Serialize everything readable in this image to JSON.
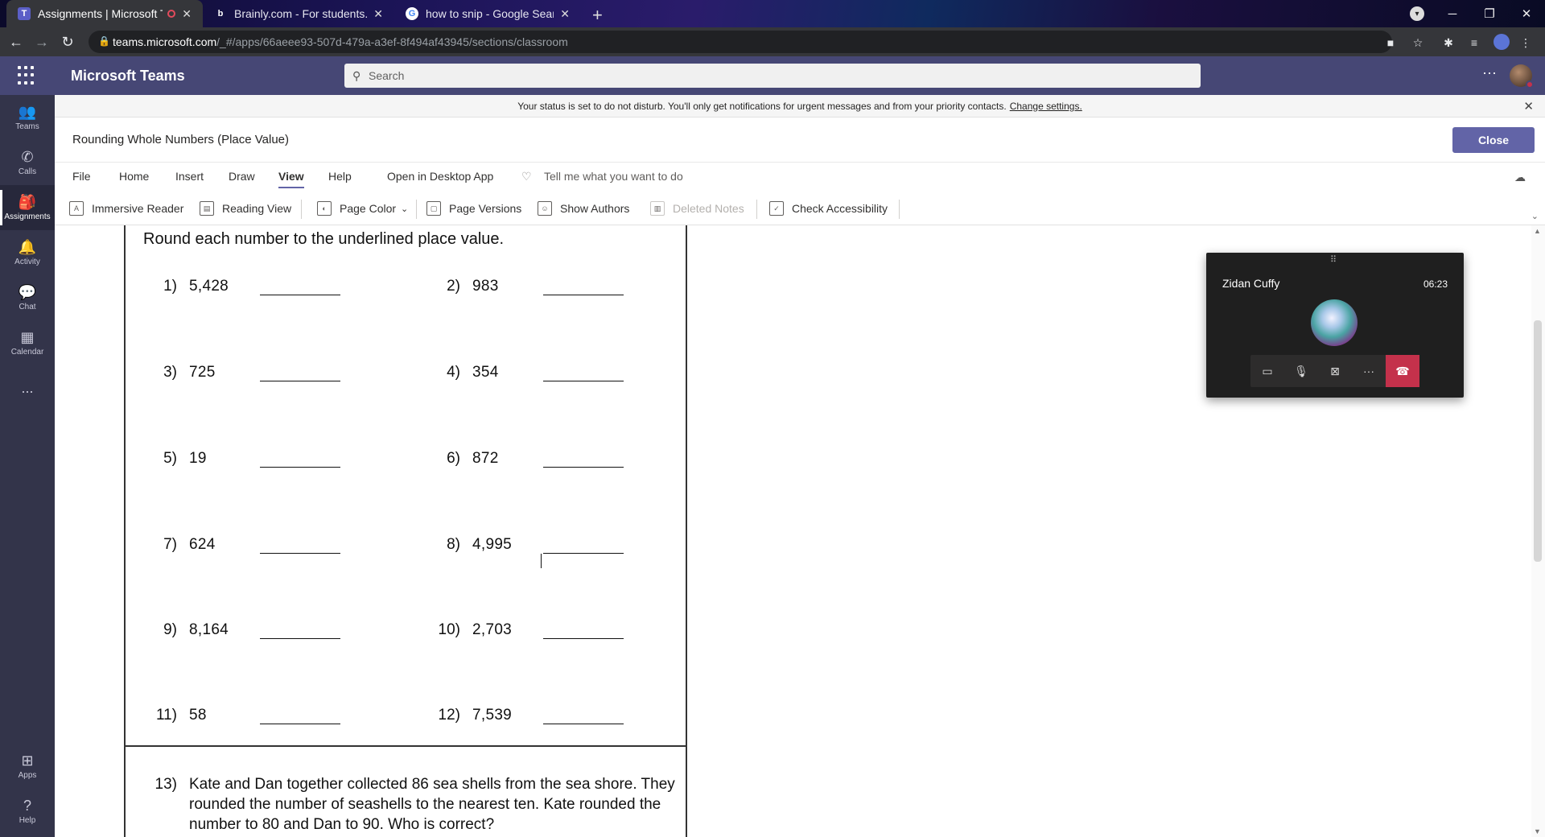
{
  "browser": {
    "tabs": [
      {
        "title": "Assignments | Microsoft Team",
        "active": true,
        "icon": "teams-icon",
        "recording": true
      },
      {
        "title": "Brainly.com - For students. By stu",
        "active": false,
        "icon": "brainly-icon"
      },
      {
        "title": "how to snip - Google Search",
        "active": false,
        "icon": "google-icon"
      }
    ],
    "url_domain": "teams.microsoft.com",
    "url_path": "/_#/apps/66aeee93-507d-479a-a3ef-8f494af43945/sections/classroom"
  },
  "teams": {
    "app_title": "Microsoft Teams",
    "search_placeholder": "Search",
    "rail": [
      {
        "label": "Teams",
        "icon": "teams-icon"
      },
      {
        "label": "Calls",
        "icon": "phone-icon"
      },
      {
        "label": "Assignments",
        "icon": "assignments-icon",
        "active": true
      },
      {
        "label": "Activity",
        "icon": "bell-icon"
      },
      {
        "label": "Chat",
        "icon": "chat-icon"
      },
      {
        "label": "Calendar",
        "icon": "calendar-icon"
      },
      {
        "label": "...",
        "icon": "more-icon"
      },
      {
        "label": "Apps",
        "icon": "apps-icon"
      },
      {
        "label": "Help",
        "icon": "help-icon"
      }
    ],
    "notification": {
      "text": "Your status is set to do not disturb. You'll only get notifications for urgent messages and from your priority contacts.",
      "link": "Change settings."
    }
  },
  "page": {
    "title": "Rounding Whole Numbers (Place Value)",
    "close_label": "Close"
  },
  "ribbon": {
    "menu": [
      "File",
      "Home",
      "Insert",
      "Draw",
      "View",
      "Help",
      "Open in Desktop App",
      "Tell me what you want to do"
    ],
    "active_menu": "View",
    "toolbar": {
      "immersive_reader": "Immersive Reader",
      "reading_view": "Reading View",
      "page_color": "Page Color",
      "page_versions": "Page Versions",
      "show_authors": "Show Authors",
      "deleted_notes": "Deleted Notes",
      "check_accessibility": "Check Accessibility"
    }
  },
  "worksheet": {
    "instruction": "Round each number to the underlined place value.",
    "problems": [
      {
        "n": "1)",
        "value": "5,428"
      },
      {
        "n": "2)",
        "value": "983"
      },
      {
        "n": "3)",
        "value": "725"
      },
      {
        "n": "4)",
        "value": "354"
      },
      {
        "n": "5)",
        "value": "19"
      },
      {
        "n": "6)",
        "value": "872"
      },
      {
        "n": "7)",
        "value": "624"
      },
      {
        "n": "8)",
        "value": "4,995"
      },
      {
        "n": "9)",
        "value": "8,164"
      },
      {
        "n": "10)",
        "value": "2,703"
      },
      {
        "n": "11)",
        "value": "58"
      },
      {
        "n": "12)",
        "value": "7,539"
      }
    ],
    "word_problem": {
      "n": "13)",
      "text": "Kate and Dan together collected 86 sea shells from the sea shore. They rounded the number of seashells to the nearest ten. Kate rounded the number to 80 and Dan to 90. Who is correct?"
    }
  },
  "call": {
    "caller": "Zidan Cuffy",
    "duration": "06:23"
  }
}
